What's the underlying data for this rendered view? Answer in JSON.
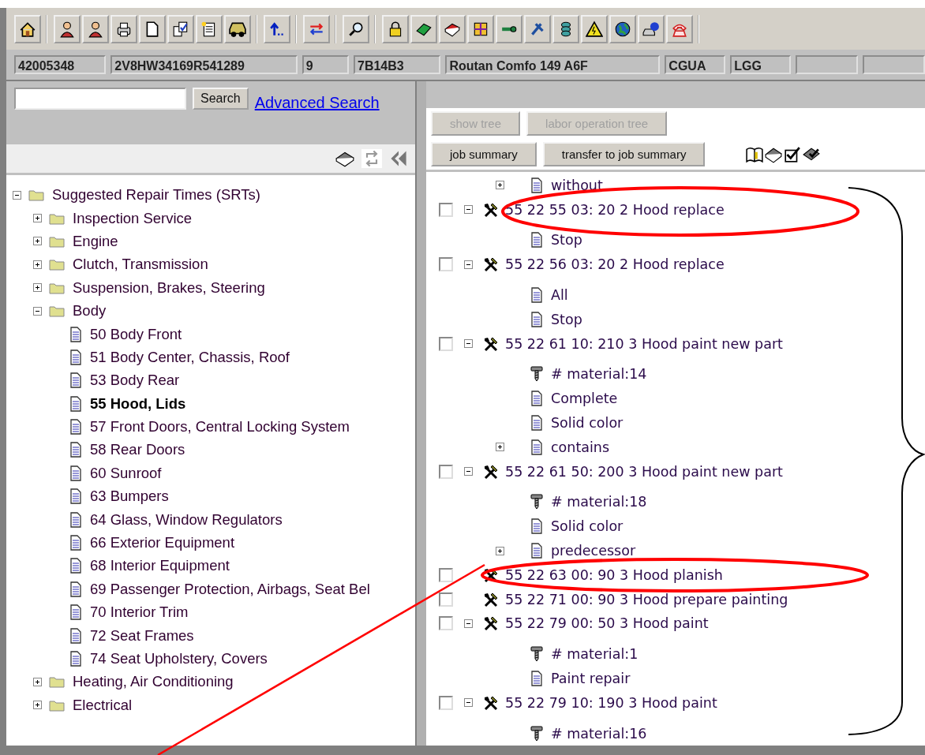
{
  "vehicle_fields": [
    "42005348",
    "2V8HW34169R541289",
    "9",
    "7B14B3",
    "Routan Comfo 149 A6F",
    "CGUA",
    "LGG"
  ],
  "left_panel": {
    "search": {
      "button": "Search",
      "link": "Advanced Search"
    },
    "tree": [
      {
        "kind": "folder",
        "label": "Suggested Repair Times (SRTs)",
        "expanded": true,
        "selected": false,
        "children": [
          {
            "kind": "folder",
            "label": "Inspection Service",
            "expanded": false,
            "selected": false
          },
          {
            "kind": "folder",
            "label": "Engine",
            "expanded": false,
            "selected": false
          },
          {
            "kind": "folder",
            "label": "Clutch, Transmission",
            "expanded": false,
            "selected": false
          },
          {
            "kind": "folder",
            "label": "Suspension, Brakes, Steering",
            "expanded": false,
            "selected": false
          },
          {
            "kind": "folder",
            "label": "Body",
            "expanded": true,
            "selected": false,
            "children": [
              {
                "kind": "document",
                "label": "50 Body Front",
                "selected": false
              },
              {
                "kind": "document",
                "label": "51 Body Center, Chassis, Roof",
                "selected": false
              },
              {
                "kind": "document",
                "label": "53 Body Rear",
                "selected": false
              },
              {
                "kind": "document",
                "label": "55 Hood, Lids",
                "selected": true
              },
              {
                "kind": "document",
                "label": "57 Front Doors, Central Locking System",
                "selected": false
              },
              {
                "kind": "document",
                "label": "58 Rear Doors",
                "selected": false
              },
              {
                "kind": "document",
                "label": "60 Sunroof",
                "selected": false
              },
              {
                "kind": "document",
                "label": "63 Bumpers",
                "selected": false
              },
              {
                "kind": "document",
                "label": "64 Glass, Window Regulators",
                "selected": false
              },
              {
                "kind": "document",
                "label": "66 Exterior Equipment",
                "selected": false
              },
              {
                "kind": "document",
                "label": "68 Interior Equipment",
                "selected": false
              },
              {
                "kind": "document",
                "label": "69 Passenger Protection, Airbags, Seat Bel",
                "selected": false
              },
              {
                "kind": "document",
                "label": "70 Interior Trim",
                "selected": false
              },
              {
                "kind": "document",
                "label": "72 Seat Frames",
                "selected": false
              },
              {
                "kind": "document",
                "label": "74 Seat Upholstery, Covers",
                "selected": false
              }
            ]
          },
          {
            "kind": "folder",
            "label": "Heating, Air Conditioning",
            "expanded": false,
            "selected": false
          },
          {
            "kind": "folder",
            "label": "Electrical",
            "expanded": false,
            "selected": false
          }
        ]
      }
    ]
  },
  "right_panel": {
    "buttons": [
      [
        {
          "label": "show tree",
          "disabled": true
        },
        {
          "label": "labor operation tree",
          "disabled": true
        }
      ],
      [
        {
          "label": "job summary",
          "disabled": false
        },
        {
          "label": "transfer to job summary",
          "disabled": false
        }
      ]
    ],
    "tree": [
      {
        "kind": "document",
        "label": "without",
        "expanded": false
      },
      {
        "kind": "job",
        "label": "55 22 55 03: 20 2 Hood replace",
        "checked": false,
        "expanded": true,
        "children": [
          {
            "kind": "document",
            "label": "Stop"
          }
        ]
      },
      {
        "kind": "job",
        "label": "55 22 56 03: 20 2 Hood replace",
        "checked": false,
        "expanded": true,
        "children": [
          {
            "kind": "document",
            "label": "All"
          },
          {
            "kind": "document",
            "label": "Stop"
          }
        ]
      },
      {
        "kind": "job",
        "label": "55 22 61 10: 210 3 Hood paint new part",
        "checked": false,
        "expanded": true,
        "children": [
          {
            "kind": "material",
            "label": "# material:14"
          },
          {
            "kind": "document",
            "label": "Complete"
          },
          {
            "kind": "document",
            "label": "Solid color"
          },
          {
            "kind": "document",
            "label": "contains",
            "expanded": false
          }
        ]
      },
      {
        "kind": "job",
        "label": "55 22 61 50: 200 3 Hood paint new part",
        "checked": false,
        "expanded": true,
        "children": [
          {
            "kind": "material",
            "label": "# material:18"
          },
          {
            "kind": "document",
            "label": "Solid color"
          },
          {
            "kind": "document",
            "label": "predecessor",
            "expanded": false
          }
        ]
      },
      {
        "kind": "job",
        "label": "55 22 63 00: 90 3 Hood planish",
        "checked": false
      },
      {
        "kind": "job",
        "label": "55 22 71 00: 90 3 Hood prepare painting",
        "checked": false
      },
      {
        "kind": "job",
        "label": "55 22 79 00: 50 3 Hood paint",
        "checked": false,
        "expanded": true,
        "children": [
          {
            "kind": "material",
            "label": "# material:1"
          },
          {
            "kind": "document",
            "label": "Paint repair"
          }
        ]
      },
      {
        "kind": "job",
        "label": "55 22 79 10: 190 3 Hood paint",
        "checked": false,
        "expanded": true,
        "children": [
          {
            "kind": "material",
            "label": "# material:16"
          }
        ]
      }
    ]
  }
}
